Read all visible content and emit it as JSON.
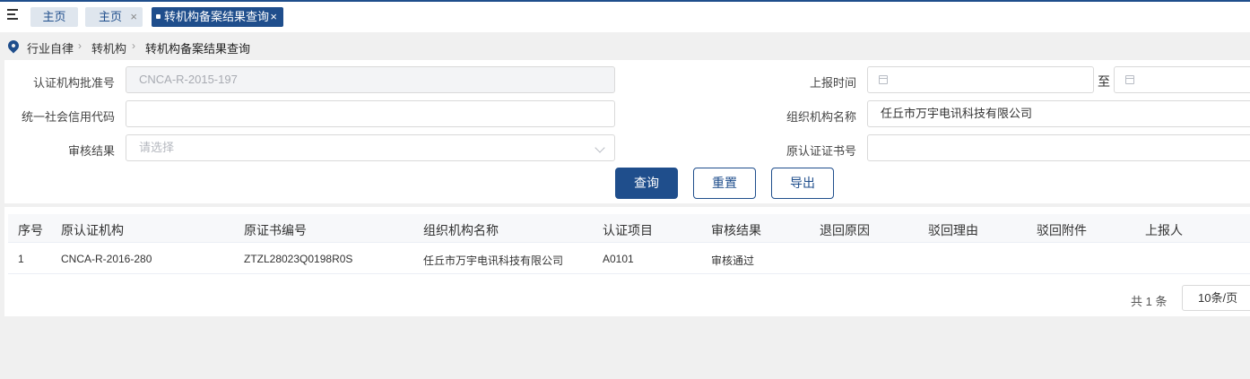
{
  "tabs": [
    {
      "label": "主页"
    },
    {
      "label": "主页",
      "close": "×"
    },
    {
      "label": "转机构备案结果查询",
      "close": "×"
    }
  ],
  "breadcrumb": [
    "行业自律",
    "转机构",
    "转机构备案结果查询"
  ],
  "breadcrumb_sep": "›",
  "form": {
    "cert_no_label": "认证机构批准号",
    "cert_no_value": "CNCA-R-2015-197",
    "credit_code_label": "统一社会信用代码",
    "credit_code_value": "",
    "review_label": "审核结果",
    "review_placeholder": "请选择",
    "report_time_label": "上报时间",
    "to_label": "至",
    "org_name_label": "组织机构名称",
    "org_name_value": "任丘市万宇电讯科技有限公司",
    "orig_cert_label": "原认证证书号",
    "orig_cert_value": ""
  },
  "buttons": {
    "query": "查询",
    "reset": "重置",
    "export": "导出"
  },
  "table": {
    "headers": [
      "序号",
      "原认证机构",
      "原证书编号",
      "组织机构名称",
      "认证项目",
      "审核结果",
      "退回原因",
      "驳回理由",
      "驳回附件",
      "上报人"
    ],
    "rows": [
      [
        "1",
        "CNCA-R-2016-280",
        "ZTZL28023Q0198R0S",
        "任丘市万宇电讯科技有限公司",
        "A0101",
        "审核通过",
        "",
        "",
        "",
        ""
      ]
    ]
  },
  "pagination": {
    "total": "共 1 条",
    "page_size": "10条/页"
  },
  "colors": {
    "primary": "#1f4e8c"
  }
}
